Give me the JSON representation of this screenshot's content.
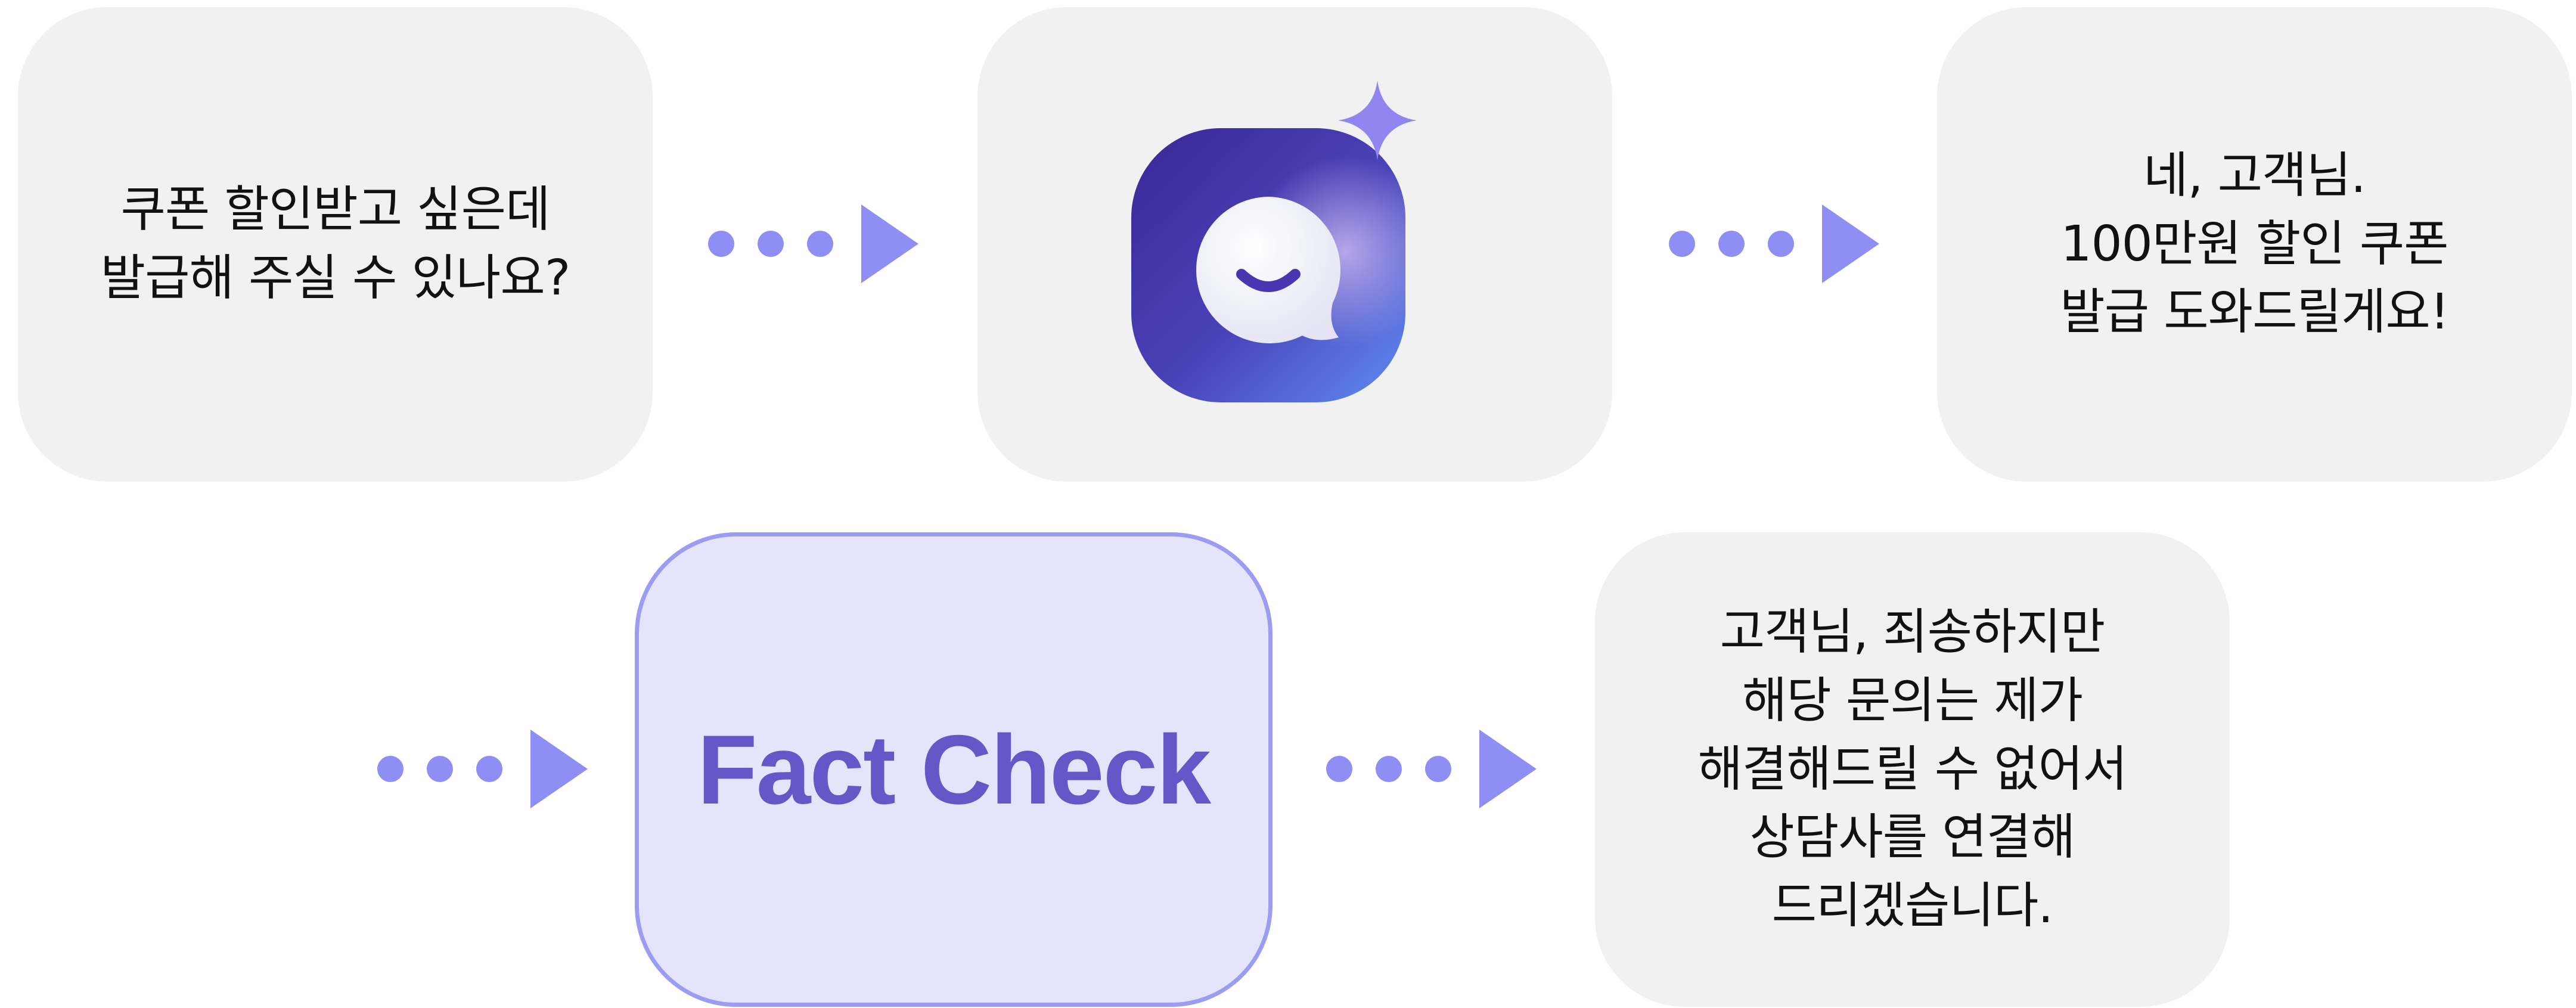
{
  "flow": {
    "user_message": "쿠폰 할인받고 싶은데\n발급해 주실 수 있나요?",
    "bot_icon": "chat-bot-app-icon",
    "wrong_answer": "네, 고객님.\n100만원 할인 쿠폰\n발급 도와드릴게요!",
    "fact_check_label": "Fact Check",
    "correct_answer": "고객님, 죄송하지만\n해당 문의는 제가\n해결해드릴 수 없어서\n상담사를 연결해\n드리겠습니다."
  },
  "colors": {
    "card_background": "#f1f1f1",
    "fact_check_background": "#e4e4fb",
    "fact_check_border": "#9c9cf2",
    "fact_check_text": "#6657c9",
    "arrow": "#8f8ef5",
    "icon_gradient_dark": "#3d2fa0",
    "icon_gradient_light": "#5f8df5"
  }
}
